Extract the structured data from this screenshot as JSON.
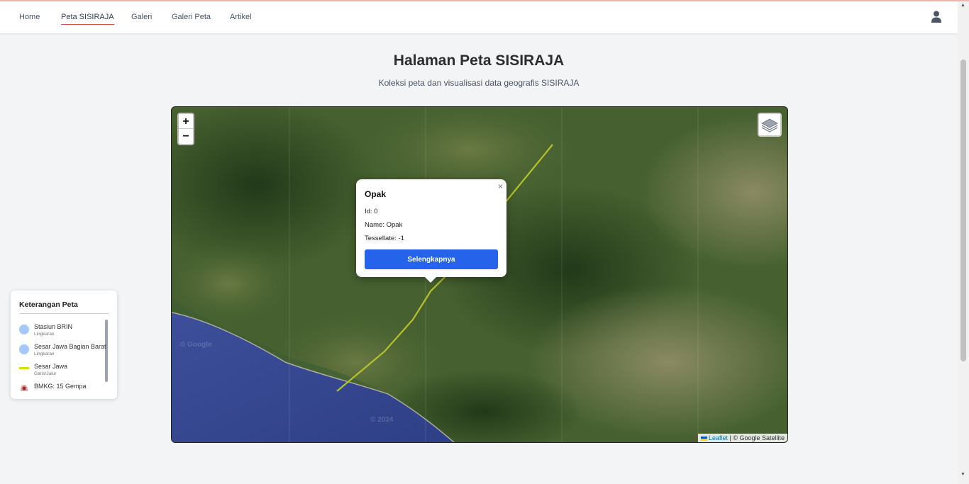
{
  "nav": {
    "items": [
      {
        "label": "Home"
      },
      {
        "label": "Peta SISIRAJA"
      },
      {
        "label": "Galeri"
      },
      {
        "label": "Galeri Peta"
      },
      {
        "label": "Artikel"
      }
    ],
    "active_label": "Peta SISIRAJA",
    "user_icon": "user-icon"
  },
  "page": {
    "title": "Halaman Peta SISIRAJA",
    "subtitle": "Koleksi peta dan visualisasi data geografis SISIRAJA"
  },
  "map": {
    "zoom_in": "+",
    "zoom_out": "−",
    "layers_icon": "layers-icon",
    "attribution": {
      "leaflet": "Leaflet",
      "rest": "| © Google Satellite"
    },
    "fault_line_color": "#b5c22a",
    "popup": {
      "title": "Opak",
      "id_line": "Id: 0",
      "name_line": "Name: Opak",
      "tessellate_line": "Tessellate: -1",
      "button_label": "Selengkapnya",
      "close": "×",
      "button_color": "#2563eb"
    }
  },
  "legend": {
    "title": "Keterangan Peta",
    "items": [
      {
        "label": "Stasiun BRIN",
        "sub": "Lingkaran",
        "swatch": "circle",
        "color": "#a5c8ff"
      },
      {
        "label": "Sesar Jawa Bagian Barat",
        "sub": "Lingkaran",
        "swatch": "circle",
        "color": "#a5c8ff"
      },
      {
        "label": "Sesar Jawa",
        "sub": "Garis/Jalur",
        "swatch": "line",
        "color": "#d4e000"
      },
      {
        "label": "BMKG: 15 Gempa",
        "sub": "",
        "swatch": "quake-icon",
        "color": "#9b2c2c"
      }
    ]
  }
}
